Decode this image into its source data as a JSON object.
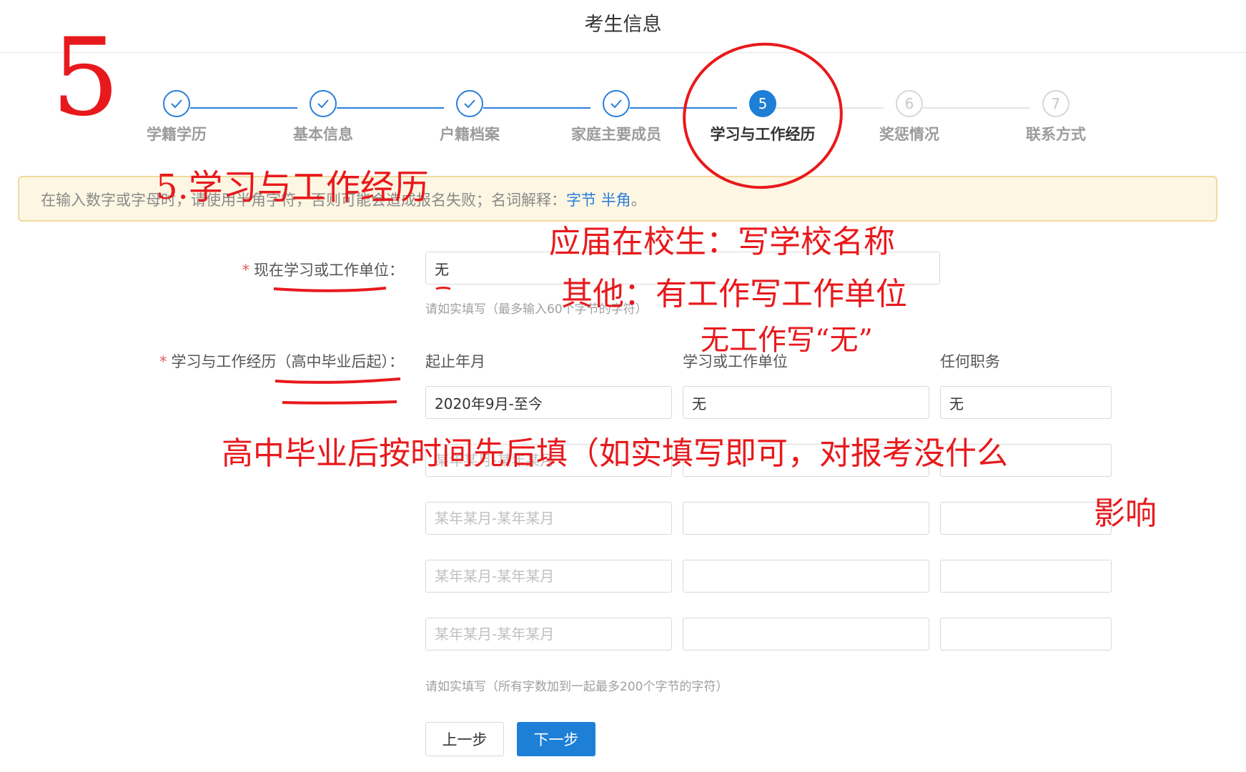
{
  "header": {
    "title": "考生信息"
  },
  "steps": [
    {
      "label": "学籍学历",
      "state": "done",
      "icon": "check-icon"
    },
    {
      "label": "基本信息",
      "state": "done",
      "icon": "check-icon"
    },
    {
      "label": "户籍档案",
      "state": "done",
      "icon": "check-icon"
    },
    {
      "label": "家庭主要成员",
      "state": "done",
      "icon": "check-icon"
    },
    {
      "number": "5",
      "label": "学习与工作经历",
      "state": "current"
    },
    {
      "number": "6",
      "label": "奖惩情况",
      "state": "wait"
    },
    {
      "number": "7",
      "label": "联系方式",
      "state": "wait"
    }
  ],
  "notice": {
    "text": "在输入数字或字母时，请使用半角字符，否则可能会造成报名失败；名词解释：",
    "link1": "字节",
    "link2": "半角",
    "end": "。"
  },
  "current_unit": {
    "label": "现在学习或工作单位：",
    "value": "无",
    "help": "请如实填写（最多输入60个字节的字符）"
  },
  "experience": {
    "label": "学习与工作经历（高中毕业后起）：",
    "headers": {
      "period": "起止年月",
      "unit": "学习或工作单位",
      "position": "任何职务"
    },
    "rows": [
      {
        "period": "2020年9月-至今",
        "unit": "无",
        "position": "无"
      },
      {
        "period": "",
        "unit": "",
        "position": ""
      },
      {
        "period": "",
        "unit": "",
        "position": ""
      },
      {
        "period": "",
        "unit": "",
        "position": ""
      },
      {
        "period": "",
        "unit": "",
        "position": ""
      }
    ],
    "period_placeholder": "某年某月-某年某月",
    "help": "请如实填写（所有字数加到一起最多200个字节的字符）"
  },
  "buttons": {
    "prev": "上一步",
    "next": "下一步"
  },
  "annotations": {
    "step_number": "5",
    "title": "5.学习与工作经历",
    "note1": "应届在校生：写学校名称",
    "note2": "其他：有工作写工作单位",
    "note3": "无工作写“无”",
    "note4": "高中毕业后按时间先后填（如实填写即可，对报考没什么",
    "note5": "影响",
    "color": "#e8191c"
  }
}
